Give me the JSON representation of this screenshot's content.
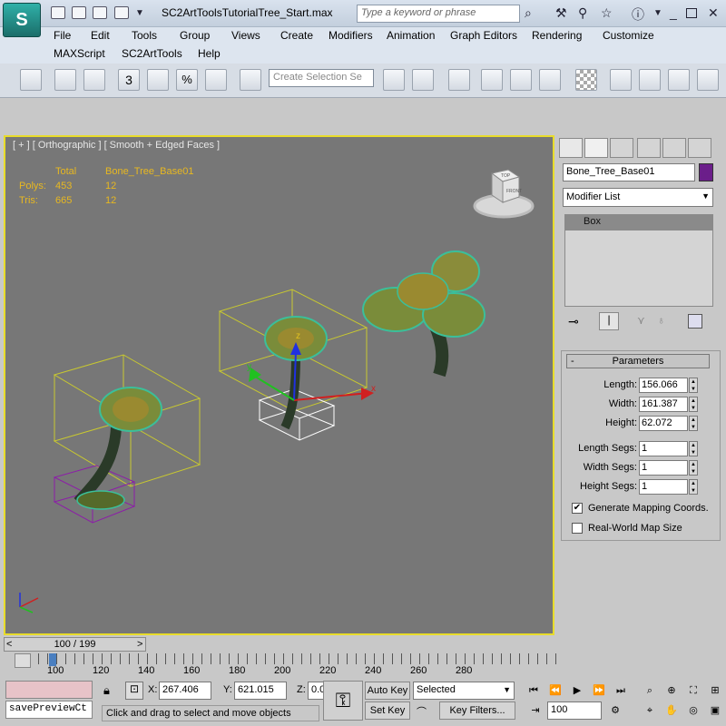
{
  "window": {
    "app_logo": "S",
    "title": "SC2ArtToolsTutorialTree_Start.max",
    "search_placeholder": "Type a keyword or phrase"
  },
  "menu": {
    "row1": [
      "File",
      "Edit",
      "Tools",
      "Group",
      "Views",
      "Create",
      "Modifiers",
      "Animation",
      "Graph Editors",
      "Rendering",
      "Customize"
    ],
    "row2": [
      "MAXScript",
      "SC2ArtTools",
      "Help"
    ]
  },
  "toolbar": {
    "selection_set_placeholder": "Create Selection Se",
    "snap_label": "3"
  },
  "viewport": {
    "label": "[ + ] [ Orthographic ] [ Smooth + Edged Faces ]",
    "stats": {
      "total_header": "Total",
      "object_header": "Bone_Tree_Base01",
      "polys_label": "Polys:",
      "polys_total": "453",
      "polys_object": "12",
      "tris_label": "Tris:",
      "tris_total": "665",
      "tris_object": "12"
    },
    "viewcube": {
      "top": "TOP",
      "front": "FRONT"
    },
    "gizmo_x": "x",
    "gizmo_y": "y",
    "gizmo_z": "z"
  },
  "command_panel": {
    "object_name": "Bone_Tree_Base01",
    "object_color": "#6b1e8a",
    "modifier_list": "Modifier List",
    "stack_item": "Box",
    "parameters": {
      "header": "Parameters",
      "length_label": "Length:",
      "length": "156.066",
      "width_label": "Width:",
      "width": "161.387",
      "height_label": "Height:",
      "height": "62.072",
      "length_segs_label": "Length Segs:",
      "length_segs": "1",
      "width_segs_label": "Width Segs:",
      "width_segs": "1",
      "height_segs_label": "Height Segs:",
      "height_segs": "1",
      "gen_mapping_label": "Generate Mapping Coords.",
      "gen_mapping_checked": true,
      "real_world_label": "Real-World Map Size",
      "real_world_checked": false
    }
  },
  "timeline": {
    "slider_label": "100 / 199",
    "prev": "<",
    "next": ">",
    "ticks": [
      "100",
      "120",
      "140",
      "160",
      "180",
      "200",
      "220",
      "240",
      "260",
      "280"
    ]
  },
  "status": {
    "maxscript_text": "savePreviewCt",
    "prompt": "Click and drag to select and move objects",
    "x_label": "X:",
    "x_value": "267.406",
    "y_label": "Y:",
    "y_value": "621.015",
    "z_label": "Z:",
    "z_value": "0.0",
    "auto_key": "Auto Key",
    "set_key": "Set Key",
    "key_mode": "Selected",
    "key_filters": "Key Filters...",
    "frame": "100"
  }
}
